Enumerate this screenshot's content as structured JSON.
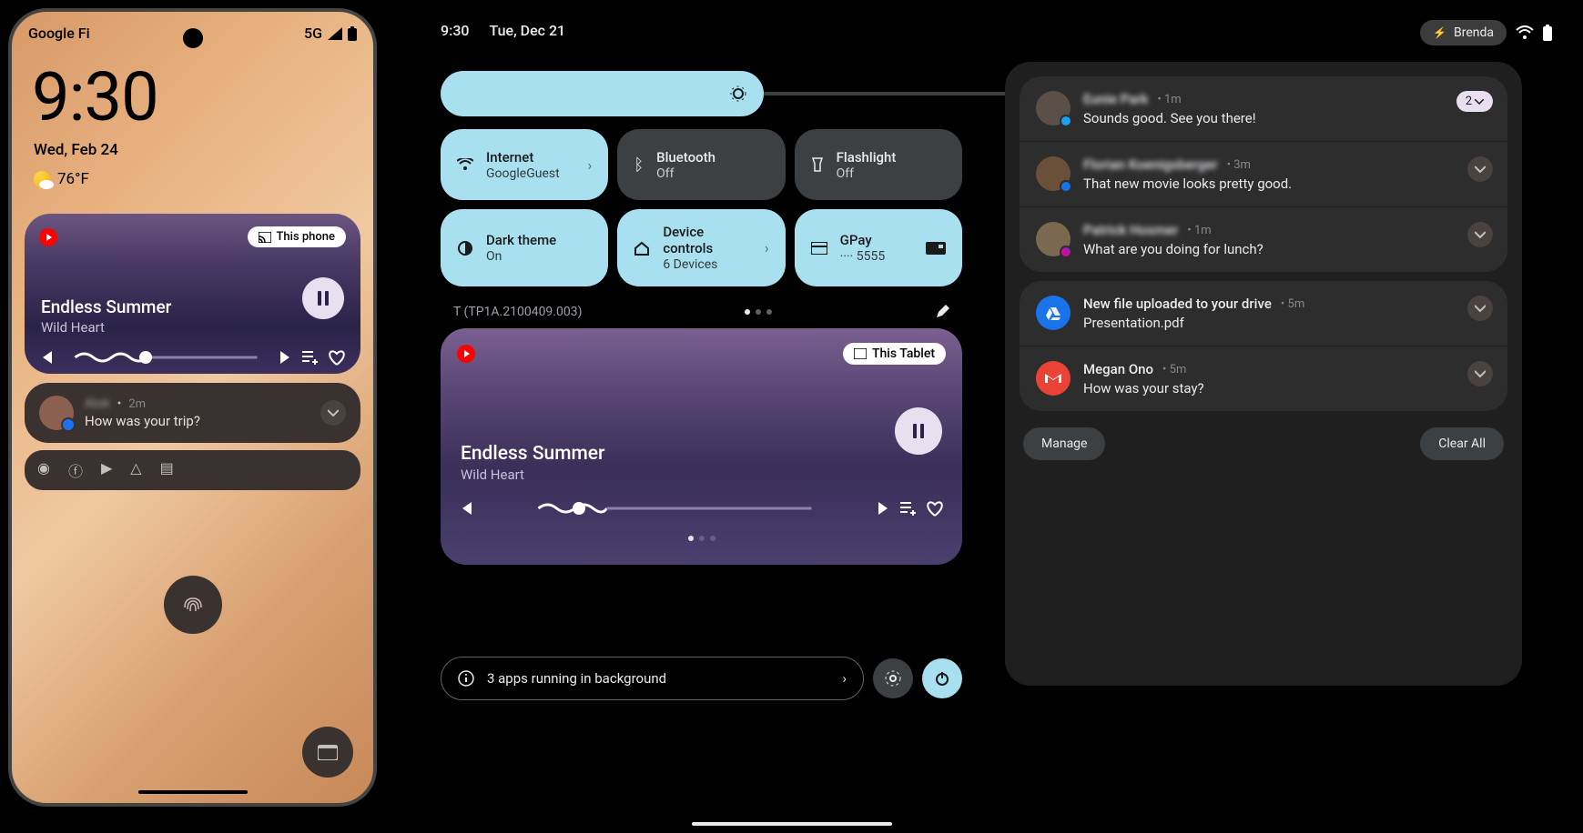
{
  "phone": {
    "carrier": "Google Fi",
    "network": "5G",
    "clock": "9:30",
    "date": "Wed, Feb 24",
    "temperature": "76°F",
    "media": {
      "cast_label": "This phone",
      "song": "Endless Summer",
      "artist": "Wild Heart"
    },
    "notif": {
      "sender": "Alok",
      "time": "2m",
      "message": "How was your trip?"
    }
  },
  "tablet": {
    "clock": "9:30",
    "date": "Tue, Dec 21",
    "user": "Brenda",
    "tiles": [
      {
        "title": "Internet",
        "sub": "GoogleGuest",
        "active": true,
        "chevron": true
      },
      {
        "title": "Bluetooth",
        "sub": "Off",
        "active": false,
        "chevron": false
      },
      {
        "title": "Flashlight",
        "sub": "Off",
        "active": false,
        "chevron": false
      },
      {
        "title": "Dark theme",
        "sub": "On",
        "active": true,
        "chevron": false
      },
      {
        "title": "Device controls",
        "sub": "6 Devices",
        "active": true,
        "chevron": true
      },
      {
        "title": "GPay",
        "sub": "···· 5555",
        "active": true,
        "chevron": false
      }
    ],
    "build": "T (TP1A.2100409.003)",
    "media": {
      "cast_label": "This Tablet",
      "song": "Endless Summer",
      "artist": "Wild Heart"
    },
    "bg_apps": "3 apps running in background",
    "notifications": {
      "group1": [
        {
          "sender": "Eunie Park",
          "time": "1m",
          "msg": "Sounds good. See you there!",
          "badge": "twitter",
          "count": "2"
        },
        {
          "sender": "Florian Koenigsberger",
          "time": "3m",
          "msg": "That new movie looks pretty good.",
          "badge": "msg"
        },
        {
          "sender": "Patrick Hosmer",
          "time": "1m",
          "msg": "What are you doing for lunch?",
          "badge": "messenger"
        }
      ],
      "group2": [
        {
          "title": "New file uploaded to your drive",
          "time": "5m",
          "sub": "Presentation.pdf",
          "icon": "drive"
        },
        {
          "title": "Megan Ono",
          "time": "5m",
          "sub": "How was your stay?",
          "icon": "gmail"
        }
      ],
      "manage": "Manage",
      "clear": "Clear All"
    }
  }
}
